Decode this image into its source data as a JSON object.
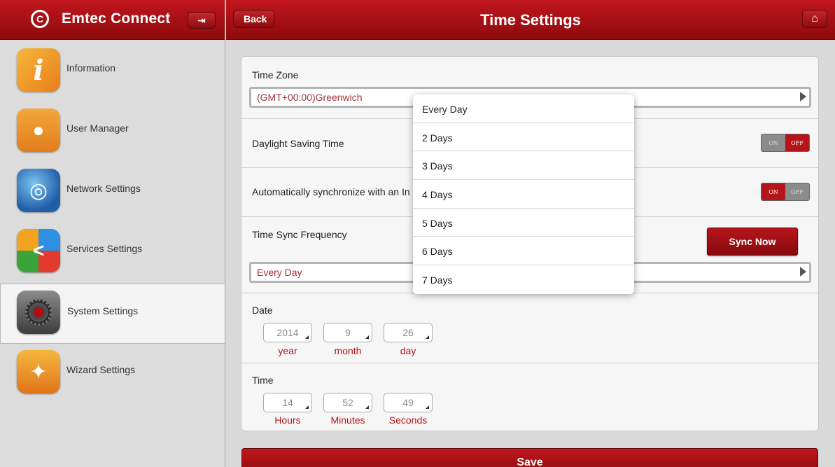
{
  "app": {
    "name": "Emtec Connect"
  },
  "header": {
    "title": "Time Settings",
    "back_label": "Back"
  },
  "sidebar": {
    "items": [
      {
        "label": "Information",
        "active": false
      },
      {
        "label": "User Manager",
        "active": false
      },
      {
        "label": "Network Settings",
        "active": false
      },
      {
        "label": "Services Settings",
        "active": false
      },
      {
        "label": "System Settings",
        "active": true
      },
      {
        "label": "Wizard Settings",
        "active": false
      }
    ]
  },
  "time_zone": {
    "label": "Time Zone",
    "value": "(GMT+00:00)Greenwich"
  },
  "dst": {
    "label": "Daylight Saving Time",
    "on_label": "ON",
    "off_label": "OFF",
    "state": "OFF"
  },
  "auto_sync": {
    "label": "Automatically synchronize with an In",
    "on_label": "ON",
    "off_label": "OFF",
    "state": "ON"
  },
  "sync_frequency": {
    "label": "Time Sync Frequency",
    "value": "Every Day",
    "sync_button": "Sync Now"
  },
  "date": {
    "label": "Date",
    "year": "2014",
    "month": "9",
    "day": "26",
    "year_unit": "year",
    "month_unit": "month",
    "day_unit": "day"
  },
  "time": {
    "label": "Time",
    "hours": "14",
    "minutes": "52",
    "seconds": "49",
    "hours_unit": "Hours",
    "minutes_unit": "Minutes",
    "seconds_unit": "Seconds"
  },
  "save_label": "Save",
  "dropdown": {
    "options": [
      "Every Day",
      "2 Days",
      "3 Days",
      "4 Days",
      "5 Days",
      "6 Days",
      "7 Days"
    ]
  },
  "colors": {
    "accent": "#b5141a",
    "header": "#a31016",
    "panel": "#f6f6f6"
  }
}
